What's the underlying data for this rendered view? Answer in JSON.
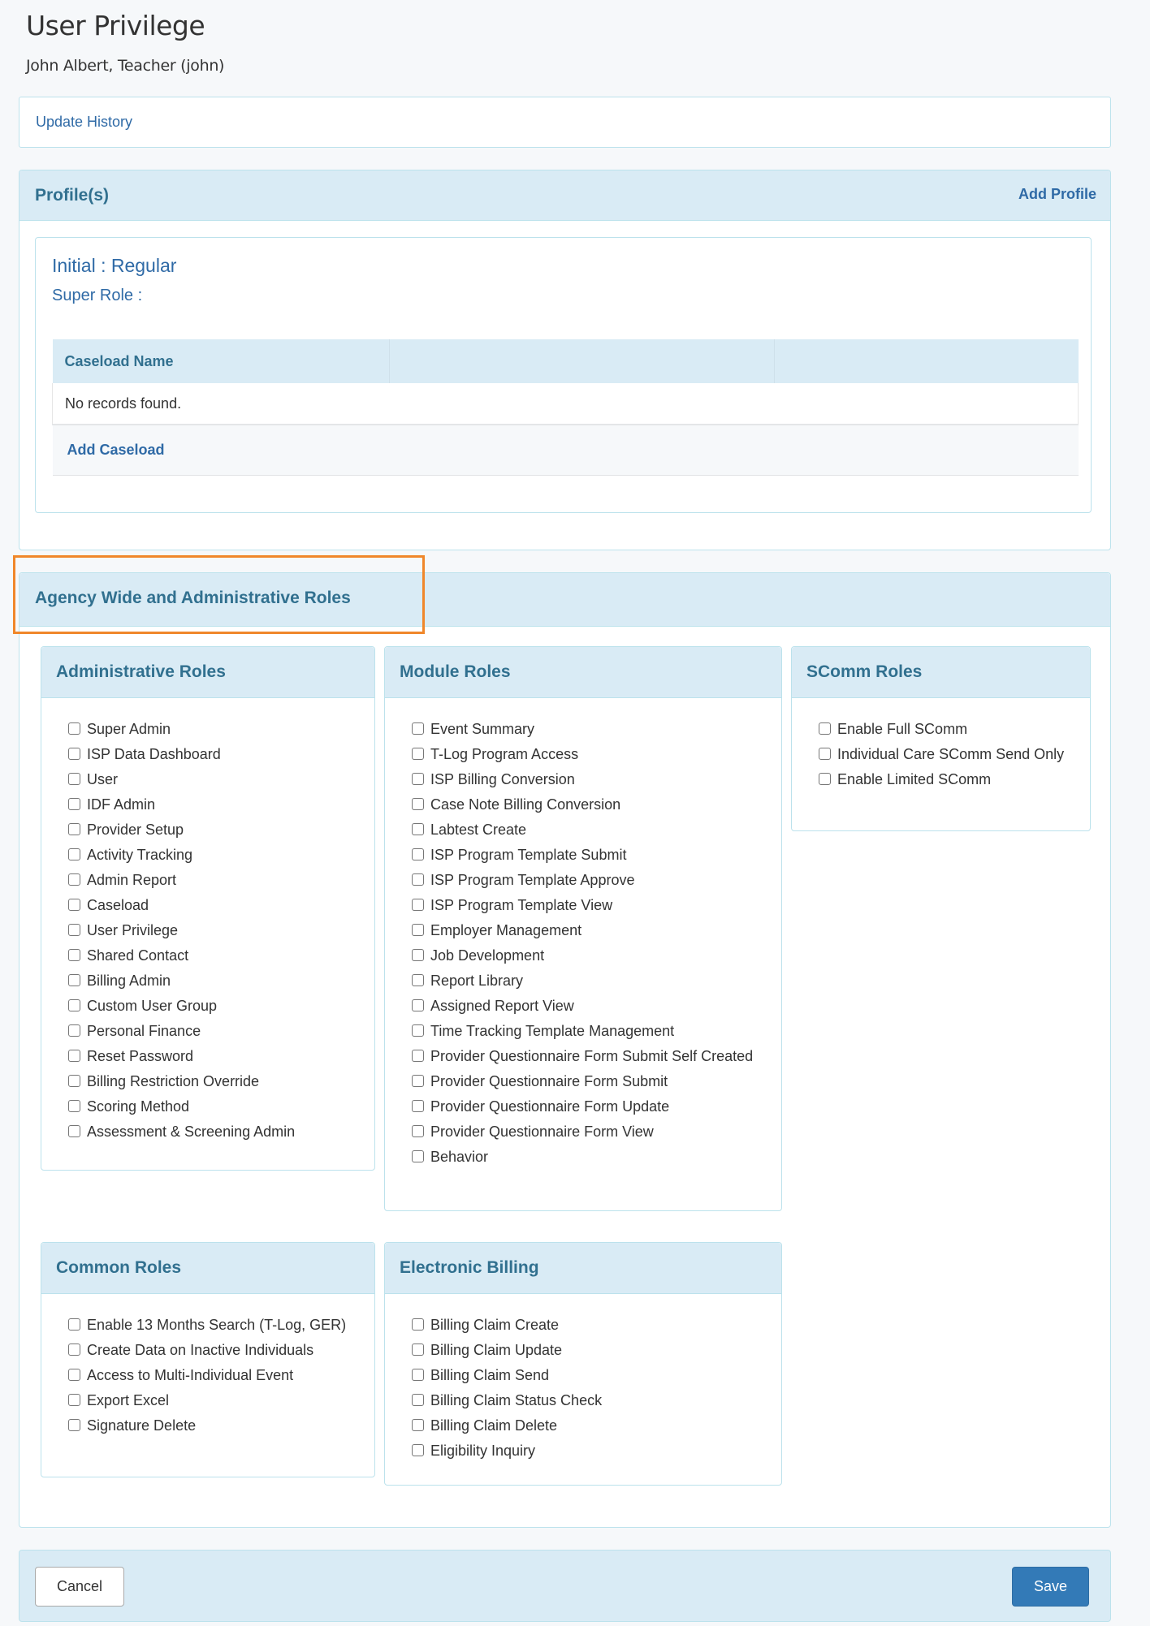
{
  "header": {
    "title": "User Privilege",
    "subtitle": "John Albert, Teacher (john)"
  },
  "history": {
    "link_label": "Update History"
  },
  "profiles": {
    "title": "Profile(s)",
    "add_label": "Add Profile",
    "initial": "Initial : Regular",
    "super_role": "Super Role :",
    "table": {
      "columns": [
        "Caseload Name",
        "",
        ""
      ],
      "empty_message": "No records found.",
      "add_label": "Add Caseload"
    }
  },
  "agency": {
    "title": "Agency Wide and Administrative Roles",
    "sections": {
      "administrative": {
        "title": "Administrative Roles",
        "items": [
          {
            "label": "Super Admin",
            "checked": false
          },
          {
            "label": "ISP Data Dashboard",
            "checked": false
          },
          {
            "label": "User",
            "checked": false
          },
          {
            "label": "IDF Admin",
            "checked": false
          },
          {
            "label": "Provider Setup",
            "checked": false
          },
          {
            "label": "Activity Tracking",
            "checked": false
          },
          {
            "label": "Admin Report",
            "checked": false
          },
          {
            "label": "Caseload",
            "checked": false
          },
          {
            "label": "User Privilege",
            "checked": false
          },
          {
            "label": "Shared Contact",
            "checked": false
          },
          {
            "label": "Billing Admin",
            "checked": false
          },
          {
            "label": "Custom User Group",
            "checked": false
          },
          {
            "label": "Personal Finance",
            "checked": false
          },
          {
            "label": "Reset Password",
            "checked": false
          },
          {
            "label": "Billing Restriction Override",
            "checked": false
          },
          {
            "label": "Scoring Method",
            "checked": false
          },
          {
            "label": "Assessment & Screening Admin",
            "checked": false
          }
        ]
      },
      "module": {
        "title": "Module Roles",
        "items": [
          {
            "label": "Event Summary",
            "checked": false
          },
          {
            "label": "T-Log Program Access",
            "checked": false
          },
          {
            "label": "ISP Billing Conversion",
            "checked": false
          },
          {
            "label": "Case Note Billing Conversion",
            "checked": false
          },
          {
            "label": "Labtest Create",
            "checked": false
          },
          {
            "label": "ISP Program Template Submit",
            "checked": false
          },
          {
            "label": "ISP Program Template Approve",
            "checked": false
          },
          {
            "label": "ISP Program Template View",
            "checked": false
          },
          {
            "label": "Employer Management",
            "checked": false
          },
          {
            "label": "Job Development",
            "checked": false
          },
          {
            "label": "Report Library",
            "checked": false
          },
          {
            "label": "Assigned Report View",
            "checked": false
          },
          {
            "label": "Time Tracking Template Management",
            "checked": false
          },
          {
            "label": "Provider Questionnaire Form Submit Self Created",
            "checked": false
          },
          {
            "label": "Provider Questionnaire Form Submit",
            "checked": false
          },
          {
            "label": "Provider Questionnaire Form Update",
            "checked": false
          },
          {
            "label": "Provider Questionnaire Form View",
            "checked": false
          },
          {
            "label": "Behavior",
            "checked": false
          }
        ]
      },
      "scomm": {
        "title": "SComm Roles",
        "items": [
          {
            "label": "Enable Full SComm",
            "checked": false
          },
          {
            "label": "Individual Care SComm Send Only",
            "checked": false
          },
          {
            "label": "Enable Limited SComm",
            "checked": false
          }
        ]
      },
      "common": {
        "title": "Common Roles",
        "items": [
          {
            "label": "Enable 13 Months Search (T-Log, GER)",
            "checked": false
          },
          {
            "label": "Create Data on Inactive Individuals",
            "checked": false
          },
          {
            "label": "Access to Multi-Individual Event",
            "checked": false
          },
          {
            "label": "Export Excel",
            "checked": false
          },
          {
            "label": "Signature Delete",
            "checked": false
          }
        ]
      },
      "billing": {
        "title": "Electronic Billing",
        "items": [
          {
            "label": "Billing Claim Create",
            "checked": false
          },
          {
            "label": "Billing Claim Update",
            "checked": false
          },
          {
            "label": "Billing Claim Send",
            "checked": false
          },
          {
            "label": "Billing Claim Status Check",
            "checked": false
          },
          {
            "label": "Billing Claim Delete",
            "checked": false
          },
          {
            "label": "Eligibility Inquiry",
            "checked": false
          }
        ]
      }
    }
  },
  "footer": {
    "cancel_label": "Cancel",
    "save_label": "Save"
  },
  "colors": {
    "panel_heading_bg": "#d9ebf5",
    "heading_text": "#31708f",
    "link": "#2f6aa6",
    "primary_button": "#337ab7",
    "highlight_outline": "#f0872a"
  }
}
